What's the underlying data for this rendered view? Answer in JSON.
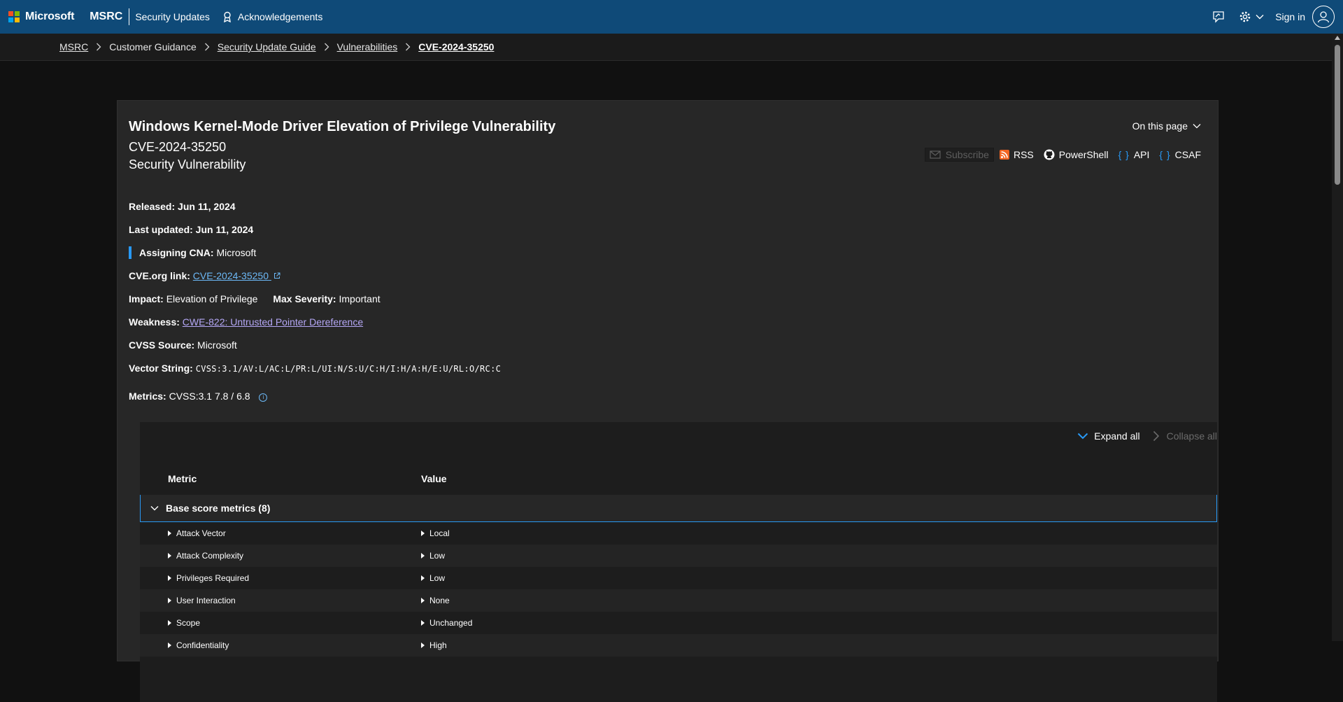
{
  "topnav": {
    "brand": "Microsoft",
    "section": "MSRC",
    "links": [
      "Security Updates",
      "Acknowledgements"
    ],
    "sign_in": "Sign in"
  },
  "breadcrumb": {
    "items": [
      "MSRC",
      "Customer Guidance",
      "Security Update Guide",
      "Vulnerabilities"
    ],
    "current": "CVE-2024-35250"
  },
  "header": {
    "title": "Windows Kernel-Mode Driver Elevation of Privilege Vulnerability",
    "cve_id": "CVE-2024-35250",
    "type": "Security Vulnerability",
    "on_this_page": "On this page"
  },
  "actions": {
    "subscribe": "Subscribe",
    "rss": "RSS",
    "powershell": "PowerShell",
    "api": "API",
    "csaf": "CSAF"
  },
  "details": {
    "released_label": "Released:",
    "released_value": "Jun 11, 2024",
    "updated_label": "Last updated:",
    "updated_value": "Jun 11, 2024",
    "cna_label": "Assigning CNA:",
    "cna_value": "Microsoft",
    "cveorg_label": "CVE.org link:",
    "cveorg_value": "CVE-2024-35250",
    "impact_label": "Impact:",
    "impact_value": "Elevation of Privilege",
    "severity_label": "Max Severity:",
    "severity_value": "Important",
    "weakness_label": "Weakness:",
    "weakness_value": "CWE-822: Untrusted Pointer Dereference",
    "source_label": "CVSS Source:",
    "source_value": "Microsoft",
    "vector_label": "Vector String:",
    "vector_value": "CVSS:3.1/AV:L/AC:L/PR:L/UI:N/S:U/C:H/I:H/A:H/E:U/RL:O/RC:C",
    "metrics_label": "Metrics:",
    "metrics_value": "CVSS:3.1 7.8 / 6.8"
  },
  "table": {
    "expand_all": "Expand all",
    "collapse_all": "Collapse all",
    "col_metric": "Metric",
    "col_value": "Value",
    "group_label": "Base score metrics (8)",
    "rows": [
      {
        "metric": "Attack Vector",
        "value": "Local"
      },
      {
        "metric": "Attack Complexity",
        "value": "Low"
      },
      {
        "metric": "Privileges Required",
        "value": "Low"
      },
      {
        "metric": "User Interaction",
        "value": "None"
      },
      {
        "metric": "Scope",
        "value": "Unchanged"
      },
      {
        "metric": "Confidentiality",
        "value": "High"
      }
    ]
  },
  "colors": {
    "nav_bg": "#0f4a78",
    "page_bg": "#111111",
    "card_bg": "#272727",
    "accent": "#2899f5",
    "link": "#6cb8f6",
    "visited_link": "#b4a7f5"
  }
}
